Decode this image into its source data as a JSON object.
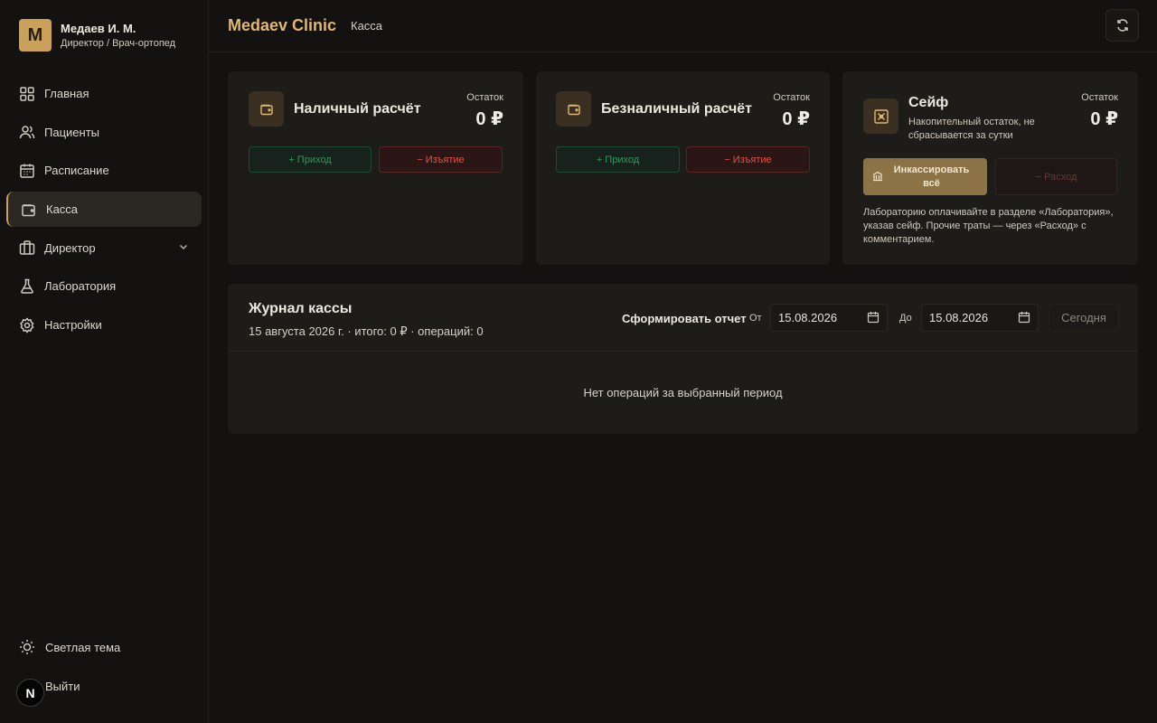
{
  "user": {
    "initial": "M",
    "name": "Медаев И. М.",
    "role": "Директор / Врач-ортопед"
  },
  "nav": [
    {
      "label": "Главная",
      "icon": "grid-icon"
    },
    {
      "label": "Пациенты",
      "icon": "users-icon"
    },
    {
      "label": "Расписание",
      "icon": "calendar-icon"
    },
    {
      "label": "Касса",
      "icon": "wallet-icon",
      "active": true
    },
    {
      "label": "Директор",
      "icon": "briefcase-icon"
    },
    {
      "label": "Лаборатория",
      "icon": "flask-icon"
    },
    {
      "label": "Настройки",
      "icon": "gear-icon"
    }
  ],
  "bottom": {
    "theme": "Светлая тема",
    "logout": "Выйти",
    "next_badge": "N"
  },
  "header": {
    "brand": "Medaev Clinic",
    "breadcrumb": "Касса"
  },
  "cards": {
    "cash": {
      "title": "Наличный расчёт",
      "rest_label": "Остаток",
      "rest_value": "0 ₽",
      "in_label": "+ Приход",
      "out_label": "− Изъятие"
    },
    "noncash": {
      "title": "Безналичный расчёт",
      "rest_label": "Остаток",
      "rest_value": "0 ₽",
      "in_label": "+ Приход",
      "out_label": "− Изъятие"
    },
    "safe": {
      "title": "Сейф",
      "subtitle_1": "Накопительный остаток, не",
      "subtitle_2": "сбрасывается за сутки",
      "rest_label": "Остаток",
      "rest_value": "0 ₽",
      "collect_1": "Инкассировать",
      "collect_2": "всё",
      "expense_label": "− Расход",
      "note": "Лабораторию оплачивайте в разделе «Лаборатория», указав сейф. Прочие траты — через «Расход» с комментарием."
    }
  },
  "journal": {
    "title": "Журнал кассы",
    "subtitle": "15 августа 2026 г. · итого: 0 ₽ · операций: 0",
    "report_label": "Сформировать отчет",
    "from_label": "От",
    "from_value": "15.08.2026",
    "to_label": "До",
    "to_value": "15.08.2026",
    "today_label": "Сегодня",
    "empty_text": "Нет операций за выбранный период"
  },
  "colors": {
    "accent": "#e0b674",
    "income": "#2f9a62",
    "withdraw": "#e0544c",
    "background": "#141210",
    "card": "#1e1c19"
  }
}
